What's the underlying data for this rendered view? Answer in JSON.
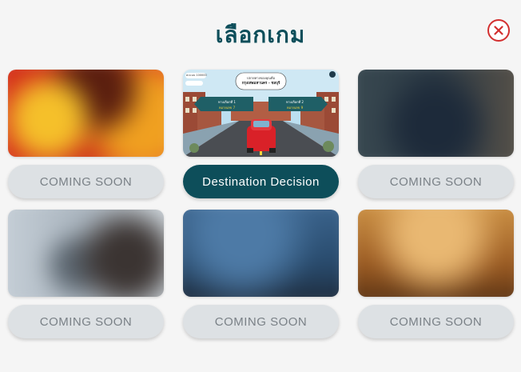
{
  "header": {
    "title": "เลือกเกม",
    "close_icon": "close-icon",
    "close_color": "#d32f2f"
  },
  "games": [
    {
      "label": "COMING SOON",
      "state": "coming-soon"
    },
    {
      "label": "Destination Decision",
      "state": "available",
      "thumbnail": {
        "score_label": "คะแนน 100000",
        "top_banner": "ปลายทางของคุณคือ",
        "destination": "กรุงเทพมหานคร - ชลบุรี",
        "left_sign": "ทางเลือกที่ 1",
        "left_sign_value": "หมายเลข 7",
        "right_sign": "ทางเลือกที่ 2",
        "right_sign_value": "หมายเลข 9"
      }
    },
    {
      "label": "COMING SOON",
      "state": "coming-soon"
    },
    {
      "label": "COMING SOON",
      "state": "coming-soon"
    },
    {
      "label": "COMING SOON",
      "state": "coming-soon"
    },
    {
      "label": "COMING SOON",
      "state": "coming-soon"
    }
  ],
  "colors": {
    "accent": "#0d4e5a",
    "background": "#f5f5f5",
    "disabled_button": "#dde1e4",
    "disabled_text": "#7a8187"
  }
}
